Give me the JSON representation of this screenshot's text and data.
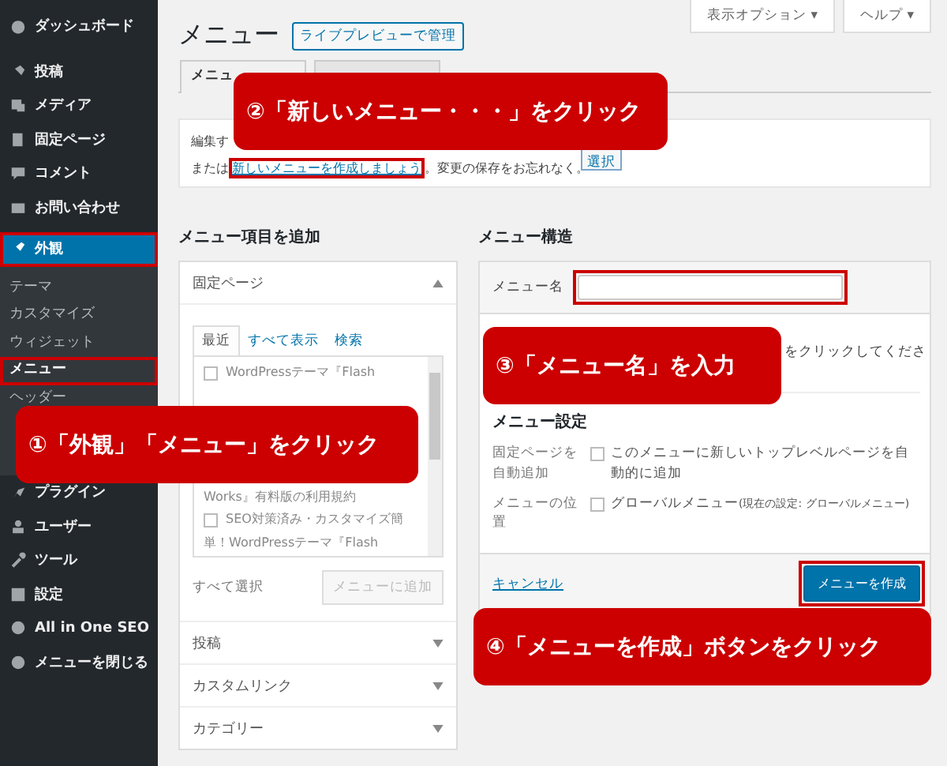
{
  "sidebar": {
    "items": [
      {
        "label": "ダッシュボード",
        "selected": false,
        "highlighted": false
      },
      {
        "label": "投稿",
        "selected": false,
        "highlighted": false
      },
      {
        "label": "メディア",
        "selected": false,
        "highlighted": false
      },
      {
        "label": "固定ページ",
        "selected": false,
        "highlighted": false
      },
      {
        "label": "コメント",
        "selected": false,
        "highlighted": false
      },
      {
        "label": "お問い合わせ",
        "selected": false,
        "highlighted": false
      },
      {
        "label": "外観",
        "selected": true,
        "highlighted": true,
        "children": [
          {
            "label": "テーマ",
            "selected": false,
            "highlighted": false
          },
          {
            "label": "カスタマイズ",
            "selected": false,
            "highlighted": false
          },
          {
            "label": "ウィジェット",
            "selected": false,
            "highlighted": false
          },
          {
            "label": "メニュー",
            "selected": true,
            "highlighted": true
          },
          {
            "label": "ヘッダー",
            "selected": false,
            "highlighted": false
          }
        ]
      },
      {
        "label": "プラグイン",
        "selected": false,
        "highlighted": false
      },
      {
        "label": "ユーザー",
        "selected": false,
        "highlighted": false
      },
      {
        "label": "ツール",
        "selected": false,
        "highlighted": false
      },
      {
        "label": "設定",
        "selected": false,
        "highlighted": false
      },
      {
        "label": "All in One SEO",
        "selected": false,
        "highlighted": false
      },
      {
        "label": "メニューを閉じる",
        "selected": false,
        "highlighted": false
      }
    ]
  },
  "page": {
    "title": "メニュー",
    "action": "ライブプレビューで管理"
  },
  "screen_buttons": [
    "表示オプション ▾",
    "ヘルプ ▾"
  ],
  "tabs": [
    {
      "label": "メニュ",
      "selected": true
    },
    {
      "selected": false
    }
  ],
  "edit_box": {
    "label": "編集す",
    "select_button": "選択",
    "prefix": "または",
    "link": "新しいメニューを作成しましょう",
    "link_highlighted": true,
    "suffix": "。変更の保存をお忘れなく。"
  },
  "add_items": {
    "heading": "メニュー項目を追加",
    "panels": [
      {
        "title": "固定ページ",
        "expanded": true
      },
      {
        "title": "投稿",
        "expanded": false
      },
      {
        "title": "カスタムリンク",
        "expanded": false
      },
      {
        "title": "カテゴリー",
        "expanded": false
      }
    ],
    "tabs": [
      {
        "label": "最近",
        "selected": true
      },
      {
        "label": "すべて表示",
        "selected": false
      },
      {
        "label": "検索",
        "selected": false
      }
    ],
    "pages": [
      {
        "kind": "item",
        "text": "WordPressテーマ『Flash",
        "checked": false
      },
      {
        "kind": "gap"
      },
      {
        "kind": "line",
        "text": "Works』有料版の利用規約"
      },
      {
        "kind": "item",
        "text": "SEO対策済み・カスタマイズ簡",
        "checked": false
      },
      {
        "kind": "line",
        "text": "単！WordPressテーマ『Flash"
      }
    ],
    "select_all": "すべて選択",
    "add_button": "メニューに追加"
  },
  "structure": {
    "heading": "メニュー構造",
    "name_label": "メニュー名",
    "name_highlighted": true,
    "hint": "をクリックしてくださ",
    "settings_heading": "メニュー設定",
    "settings": [
      {
        "label": "固定ページを自動追加",
        "option": "このメニューに新しいトップレベルページを自動的に追加",
        "checked": false
      },
      {
        "label": "メニューの位置",
        "option": "グローバルメニュー",
        "note": "(現在の設定: グローバルメニュー)",
        "checked": false
      }
    ],
    "cancel": "キャンセル",
    "create_button": "メニューを作成",
    "create_highlighted": true
  },
  "callouts": [
    {
      "text": "①「外観」「メニュー」をクリック"
    },
    {
      "text": "②「新しいメニュー・・・」をクリック"
    },
    {
      "text": "③「メニュー名」を入力"
    },
    {
      "text": "④「メニューを作成」ボタンをクリック"
    }
  ]
}
